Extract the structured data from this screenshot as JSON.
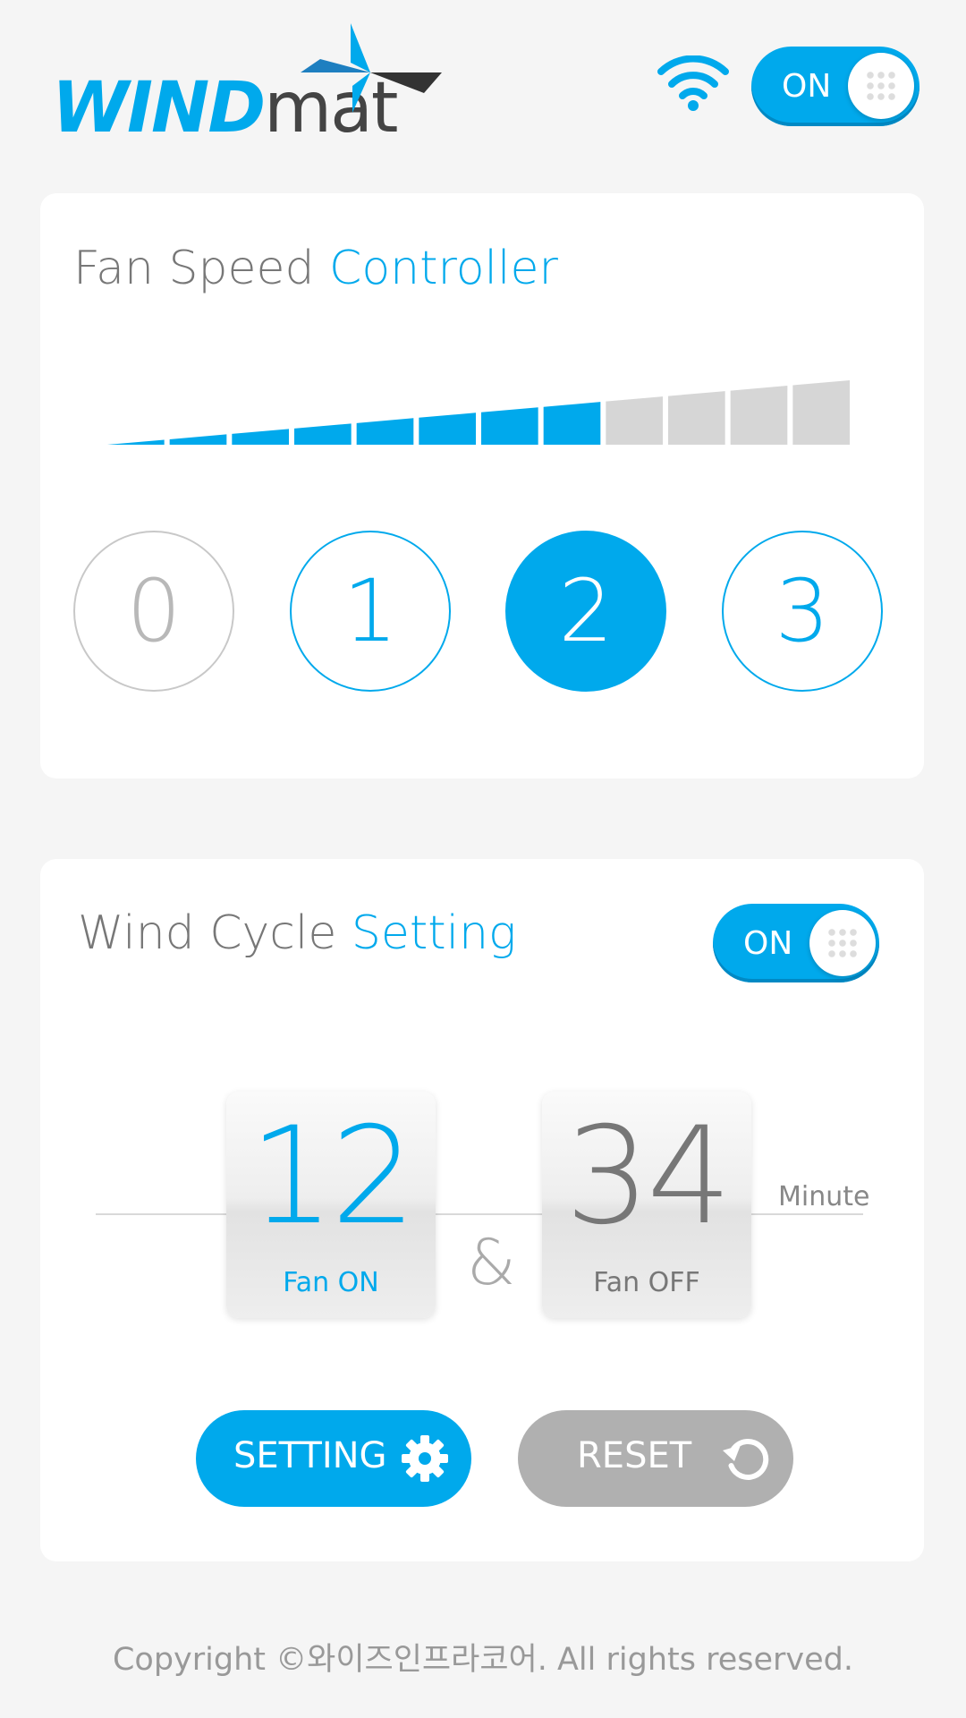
{
  "header": {
    "logo": {
      "wind": "WIND",
      "mat": "mat"
    },
    "wifi_icon": "wifi-icon",
    "power_toggle": {
      "label": "ON",
      "state": true
    }
  },
  "fan_speed": {
    "title_primary": "Fan Speed",
    "title_accent": "Controller",
    "level_bar": {
      "segments_total": 12,
      "segments_filled": 8
    },
    "buttons": [
      "0",
      "1",
      "2",
      "3"
    ],
    "selected": "2"
  },
  "wind_cycle": {
    "title_primary": "Wind Cycle",
    "title_accent": "Setting",
    "toggle": {
      "label": "ON",
      "state": true
    },
    "fan_on": {
      "value": "12",
      "caption": "Fan ON"
    },
    "separator": "&",
    "fan_off": {
      "value": "34",
      "caption": "Fan OFF"
    },
    "unit": "Minute",
    "setting_button": {
      "label": "SETTING",
      "icon": "gear-icon"
    },
    "reset_button": {
      "label": "RESET",
      "icon": "reset-icon"
    }
  },
  "footer": {
    "copyright": "Copyright ©와이즈인프라코어. All rights reserved."
  },
  "colors": {
    "accent": "#00a9ec",
    "inactive": "#d6d6d6",
    "reset": "#b0b0b0",
    "background": "#f5f5f5"
  }
}
